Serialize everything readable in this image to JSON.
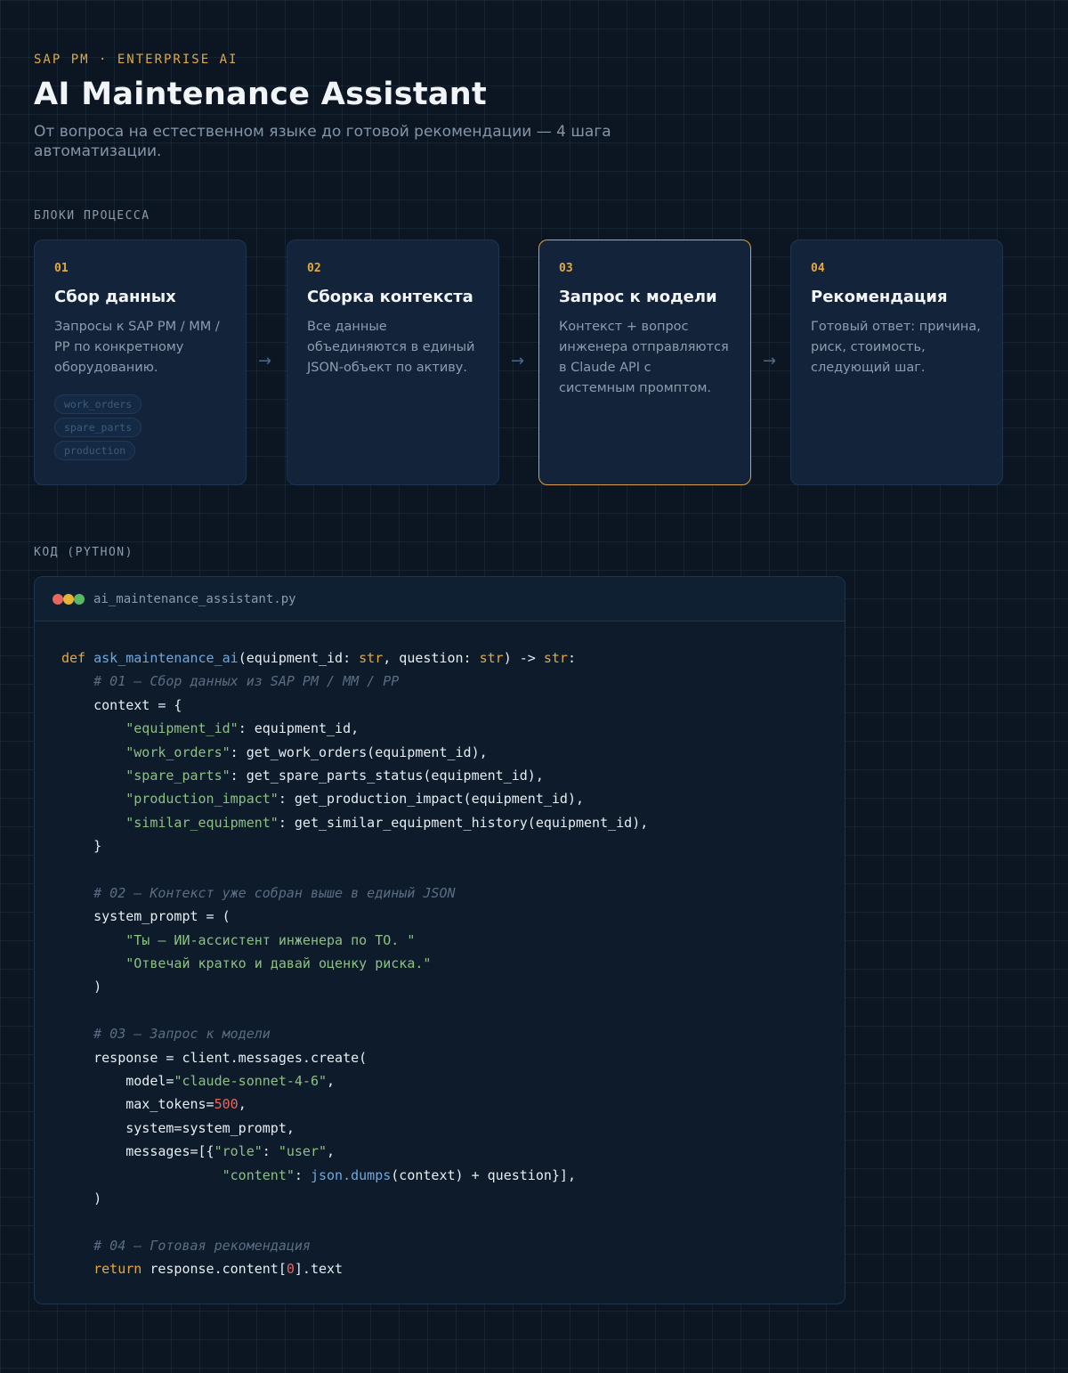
{
  "header": {
    "eyebrow": "SAP PM · ENTERPRISE AI",
    "title": "AI Maintenance Assistant",
    "subtitle": "От вопроса на естественном языке до готовой рекомендации — 4 шага автоматизации."
  },
  "process": {
    "label": "БЛОКИ ПРОЦЕССА",
    "steps": [
      {
        "num": "01",
        "title": "Сбор данных",
        "desc": "Запросы к SAP PM / MM / PP по конкретному оборудованию.",
        "tags": [
          "work_orders",
          "spare_parts",
          "production"
        ]
      },
      {
        "num": "02",
        "title": "Сборка контекста",
        "desc": "Все данные объединяются в единый JSON-объект по активу."
      },
      {
        "num": "03",
        "title": "Запрос к модели",
        "desc": "Контекст + вопрос инженера отправляются в Claude API с системным промптом.",
        "active": true
      },
      {
        "num": "04",
        "title": "Рекомендация",
        "desc": "Готовый ответ: причина, риск, стоимость, следующий шаг."
      }
    ],
    "arrow": "→"
  },
  "code": {
    "label": "КОД (PYTHON)",
    "filename": "ai_maintenance_assistant.py",
    "lines": [
      [
        [
          "kw",
          "def "
        ],
        [
          "fn",
          "ask_maintenance_ai"
        ],
        [
          "",
          "(equipment_id: "
        ],
        [
          "ty",
          "str"
        ],
        [
          "",
          ", question: "
        ],
        [
          "ty",
          "str"
        ],
        [
          "",
          ") -> "
        ],
        [
          "ty",
          "str"
        ],
        [
          "",
          ":"
        ]
      ],
      [
        [
          "",
          "    "
        ],
        [
          "cm",
          "# 01 — Сбор данных из SAP PM / MM / PP"
        ]
      ],
      [
        [
          "",
          "    context = {"
        ]
      ],
      [
        [
          "",
          "        "
        ],
        [
          "str",
          "\"equipment_id\""
        ],
        [
          "",
          ": equipment_id,"
        ]
      ],
      [
        [
          "",
          "        "
        ],
        [
          "str",
          "\"work_orders\""
        ],
        [
          "",
          ": get_work_orders(equipment_id),"
        ]
      ],
      [
        [
          "",
          "        "
        ],
        [
          "str",
          "\"spare_parts\""
        ],
        [
          "",
          ": get_spare_parts_status(equipment_id),"
        ]
      ],
      [
        [
          "",
          "        "
        ],
        [
          "str",
          "\"production_impact\""
        ],
        [
          "",
          ": get_production_impact(equipment_id),"
        ]
      ],
      [
        [
          "",
          "        "
        ],
        [
          "str",
          "\"similar_equipment\""
        ],
        [
          "",
          ": get_similar_equipment_history(equipment_id),"
        ]
      ],
      [
        [
          "",
          "    }"
        ]
      ],
      [],
      [
        [
          "",
          "    "
        ],
        [
          "cm",
          "# 02 — Контекст уже собран выше в единый JSON"
        ]
      ],
      [
        [
          "",
          "    system_prompt = ("
        ]
      ],
      [
        [
          "",
          "        "
        ],
        [
          "str",
          "\"Ты — ИИ-ассистент инженера по ТО. \""
        ]
      ],
      [
        [
          "",
          "        "
        ],
        [
          "str",
          "\"Отвечай кратко и давай оценку риска.\""
        ]
      ],
      [
        [
          "",
          "    )"
        ]
      ],
      [],
      [
        [
          "",
          "    "
        ],
        [
          "cm",
          "# 03 — Запрос к модели"
        ]
      ],
      [
        [
          "",
          "    response = client.messages.create("
        ]
      ],
      [
        [
          "",
          "        model="
        ],
        [
          "str",
          "\"claude-sonnet-4-6\""
        ],
        [
          "",
          ","
        ]
      ],
      [
        [
          "",
          "        max_tokens="
        ],
        [
          "num",
          "500"
        ],
        [
          "",
          ","
        ]
      ],
      [
        [
          "",
          "        system=system_prompt,"
        ]
      ],
      [
        [
          "",
          "        messages=[{"
        ],
        [
          "str",
          "\"role\""
        ],
        [
          "",
          ": "
        ],
        [
          "str",
          "\"user\""
        ],
        [
          "",
          ","
        ]
      ],
      [
        [
          "",
          "                    "
        ],
        [
          "str",
          "\"content\""
        ],
        [
          "",
          ": "
        ],
        [
          "mth",
          "json.dumps"
        ],
        [
          "",
          "(context) + question}],"
        ]
      ],
      [
        [
          "",
          "    )"
        ]
      ],
      [],
      [
        [
          "",
          "    "
        ],
        [
          "cm",
          "# 04 — Готовая рекомендация"
        ]
      ],
      [
        [
          "",
          "    "
        ],
        [
          "kw",
          "return"
        ],
        [
          "",
          " response.content["
        ],
        [
          "num",
          "0"
        ],
        [
          "",
          "].text"
        ]
      ]
    ]
  }
}
